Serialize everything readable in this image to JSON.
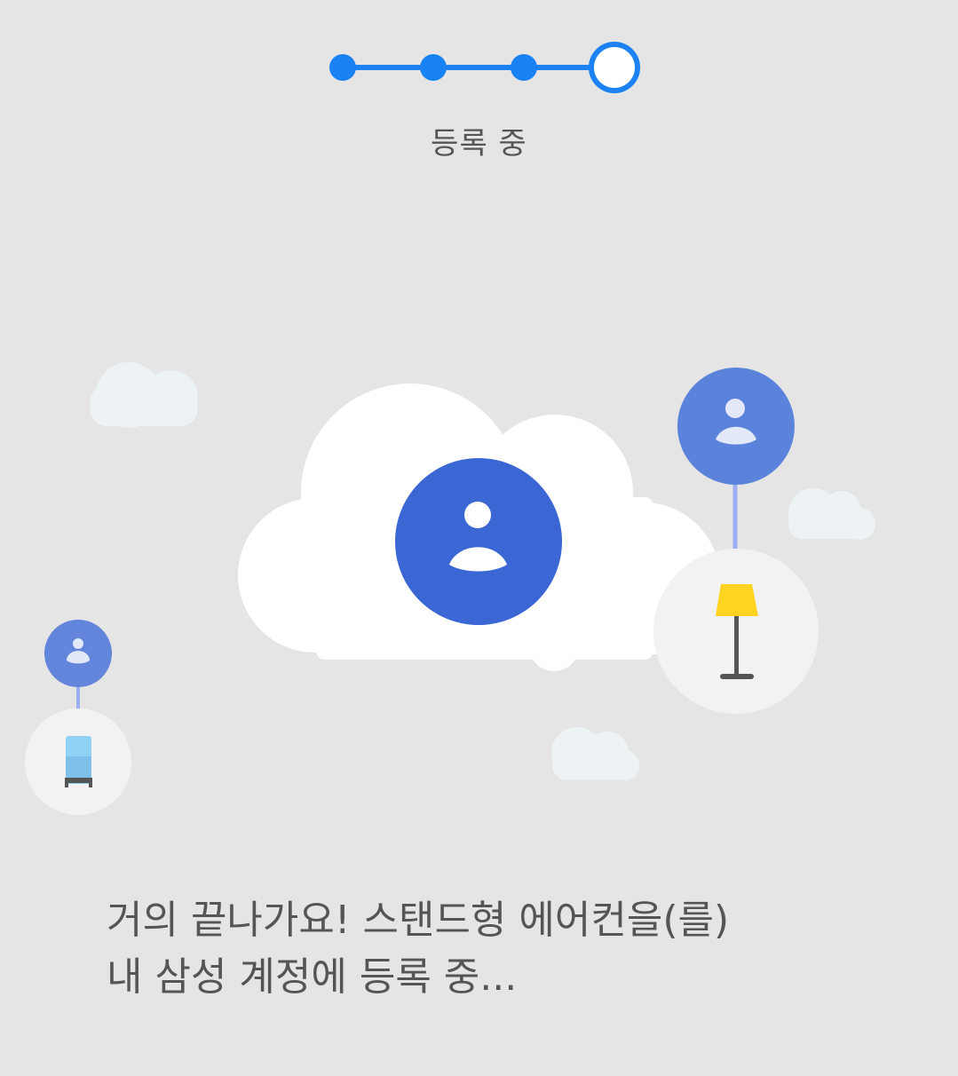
{
  "progress": {
    "total_steps": 4,
    "completed_steps": 3,
    "current_step": 4,
    "label": "등록 중",
    "active_color": "#1a82f5",
    "line_color": "#1a82f5"
  },
  "illustration": {
    "main_icon": "account-icon",
    "cloud_color": "#ffffff",
    "account_color": "#3a67d4",
    "devices": [
      {
        "name": "account-icon",
        "device": "standing-lamp-icon"
      },
      {
        "name": "account-icon",
        "device": "air-purifier-icon"
      }
    ]
  },
  "message": {
    "line1": "거의 끝나가요! 스탠드형 에어컨을(를)",
    "line2": "내 삼성 계정에 등록 중..."
  }
}
